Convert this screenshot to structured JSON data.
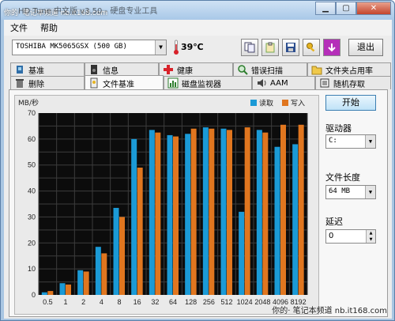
{
  "window": {
    "title": "HD Tune 中文版 v3.50 - 硬盘专业工具",
    "watermark_top": "你的· 笔记本频道 nb.it168.com",
    "watermark_bottom": "你的· 笔记本频道  nb.it168.com"
  },
  "menu": {
    "items": [
      "文件",
      "帮助"
    ]
  },
  "toolbar": {
    "drive": "TOSHIBA MK5065GSX (500 GB)",
    "temperature": "39℃",
    "exit_label": "退出"
  },
  "tabs": {
    "row1": [
      {
        "label": "基准",
        "icon": "benchmark-icon"
      },
      {
        "label": "信息",
        "icon": "info-icon"
      },
      {
        "label": "健康",
        "icon": "health-icon"
      },
      {
        "label": "错误扫描",
        "icon": "error-scan-icon"
      },
      {
        "label": "文件夹占用率",
        "icon": "folder-usage-icon"
      }
    ],
    "row2": [
      {
        "label": "删除",
        "icon": "trash-icon"
      },
      {
        "label": "文件基准",
        "icon": "file-benchmark-icon",
        "active": true
      },
      {
        "label": "磁盘监视器",
        "icon": "disk-monitor-icon"
      },
      {
        "label": "AAM",
        "icon": "speaker-icon"
      },
      {
        "label": "随机存取",
        "icon": "random-access-icon"
      }
    ]
  },
  "side": {
    "start_label": "开始",
    "drive_label": "驱动器",
    "drive_value": "C:",
    "length_label": "文件长度",
    "length_value": "64 MB",
    "delay_label": "延迟",
    "delay_value": "0"
  },
  "chart_data": {
    "type": "bar",
    "ylabel": "MB/秒",
    "ylim": [
      0,
      70
    ],
    "yticks": [
      0,
      10,
      20,
      30,
      40,
      50,
      60,
      70
    ],
    "categories": [
      "0.5",
      "1",
      "2",
      "4",
      "8",
      "16",
      "32",
      "64",
      "128",
      "256",
      "512",
      "1024",
      "2048",
      "4096",
      "8192"
    ],
    "series": [
      {
        "name": "读取",
        "color": "#1b9ad6",
        "values": [
          1,
          4.5,
          9.5,
          18.5,
          33.5,
          60,
          63.5,
          61.5,
          62,
          64.5,
          64,
          32,
          63.5,
          57,
          58
        ]
      },
      {
        "name": "写入",
        "color": "#e0761f",
        "values": [
          1.5,
          4,
          9,
          16,
          30,
          49,
          62.5,
          61,
          64,
          64,
          63.5,
          64.5,
          62.5,
          65.5,
          65.5
        ]
      }
    ],
    "grid": true,
    "legend": "top-right"
  }
}
